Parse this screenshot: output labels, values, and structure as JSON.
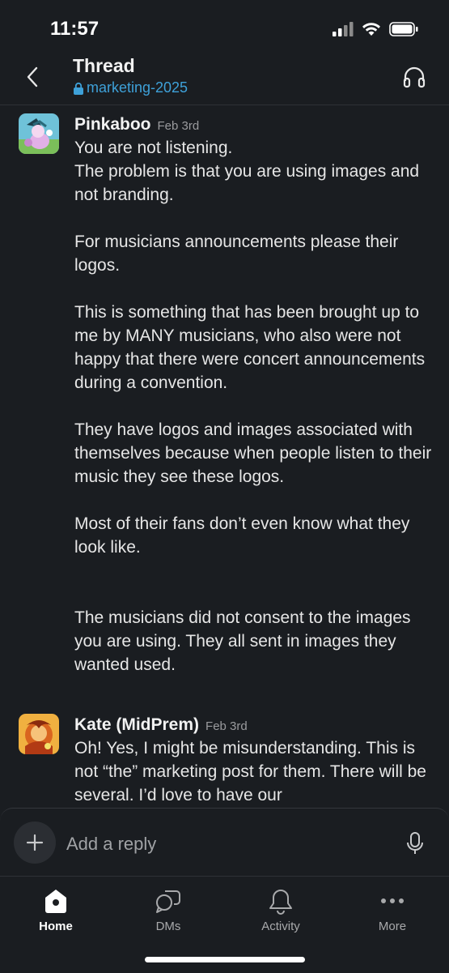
{
  "status_bar": {
    "time": "11:57"
  },
  "header": {
    "title": "Thread",
    "channel": "marketing-2025"
  },
  "messages": [
    {
      "author": "Pinkaboo",
      "time": "Feb 3rd",
      "text": "You are not listening.\nThe problem is that you are using images and not branding.\n\nFor musicians announcements please their logos.\n\nThis is something that has been brought up to me by MANY musicians, who also were not happy that there were concert announcements during a convention.\n\nThey have logos and images associated with themselves because when people listen to their music they see these logos.\n\nMost of their fans don’t even know what they look like.\n\n\nThe musicians did not consent to the images you are using. They all sent in images they wanted used."
    },
    {
      "author": "Kate (MidPrem)",
      "time": "Feb 3rd",
      "text": "Oh! Yes, I might be misunderstanding. This is not “the” marketing post for them. There will be several. I’d love to have our"
    }
  ],
  "composer": {
    "placeholder": "Add a reply"
  },
  "tabs": [
    {
      "label": "Home",
      "icon": "home-icon"
    },
    {
      "label": "DMs",
      "icon": "dms-icon"
    },
    {
      "label": "Activity",
      "icon": "bell-icon"
    },
    {
      "label": "More",
      "icon": "more-icon"
    }
  ],
  "colors": {
    "background": "#1a1d21",
    "link": "#3ea1d9"
  }
}
